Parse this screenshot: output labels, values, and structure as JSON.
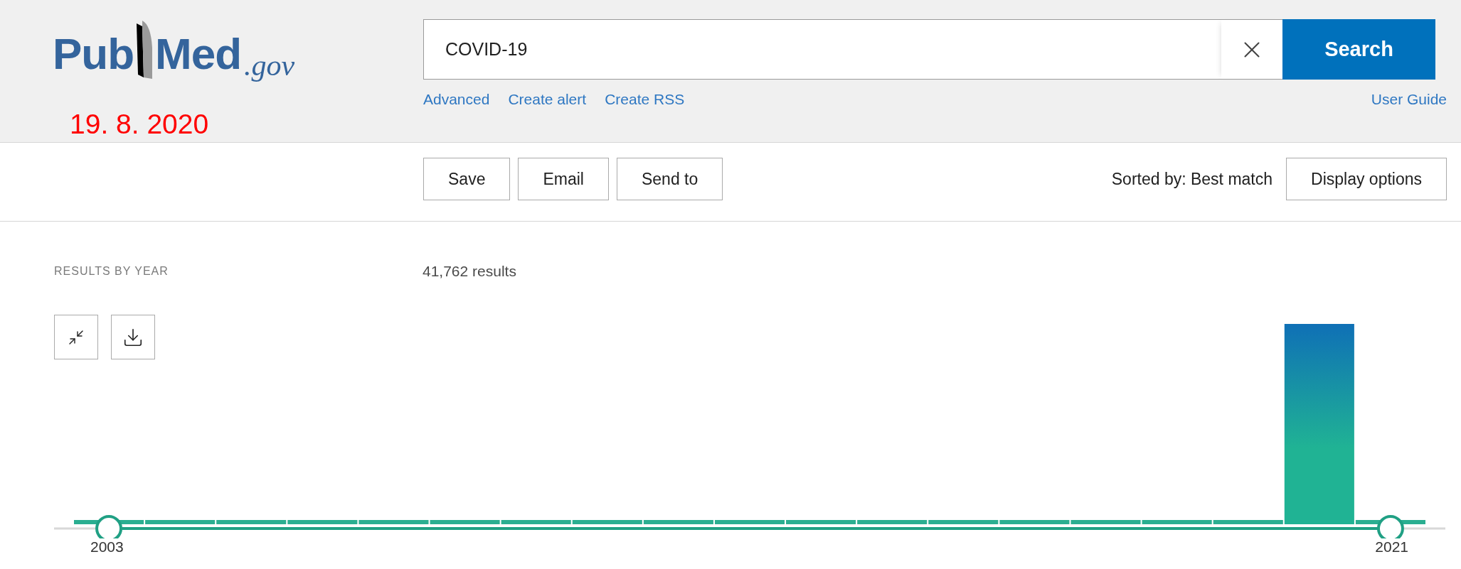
{
  "header": {
    "logo": {
      "parts": [
        "Pub",
        "Med",
        ".gov"
      ]
    },
    "date": "19. 8. 2020",
    "search": {
      "value": "COVID-19",
      "button": "Search"
    },
    "links": [
      "Advanced",
      "Create alert",
      "Create RSS"
    ],
    "user_guide": "User Guide"
  },
  "toolbar": {
    "actions": [
      "Save",
      "Email",
      "Send to"
    ],
    "sort": "Sorted by: Best match",
    "display_options": "Display options"
  },
  "results": {
    "heading": "RESULTS BY YEAR",
    "count": "41,762 results",
    "timeline": {
      "start": "2003",
      "end": "2021"
    }
  }
}
